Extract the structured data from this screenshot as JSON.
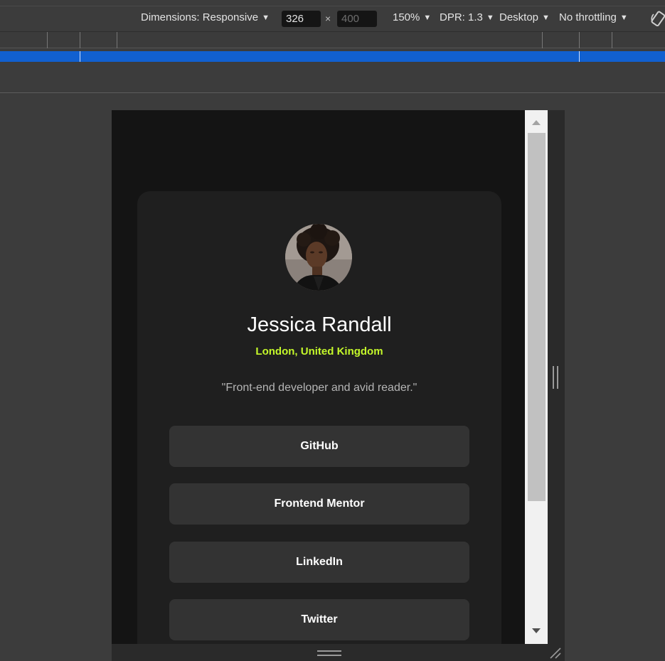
{
  "toolbar": {
    "dimensions_label": "Dimensions: Responsive",
    "width_value": "326",
    "height_placeholder": "400",
    "times": "×",
    "zoom": "150%",
    "dpr": "DPR: 1.3",
    "device_type": "Desktop",
    "throttling": "No throttling"
  },
  "profile": {
    "name": "Jessica Randall",
    "location": "London, United Kingdom",
    "bio": "\"Front-end developer and avid reader.\"",
    "links": [
      "GitHub",
      "Frontend Mentor",
      "LinkedIn",
      "Twitter"
    ]
  },
  "colors": {
    "accent": "#c4f82a",
    "card_bg": "#1f1f1f",
    "button_bg": "#333333",
    "page_bg": "#141414",
    "media_query_bar": "#1160d0"
  }
}
